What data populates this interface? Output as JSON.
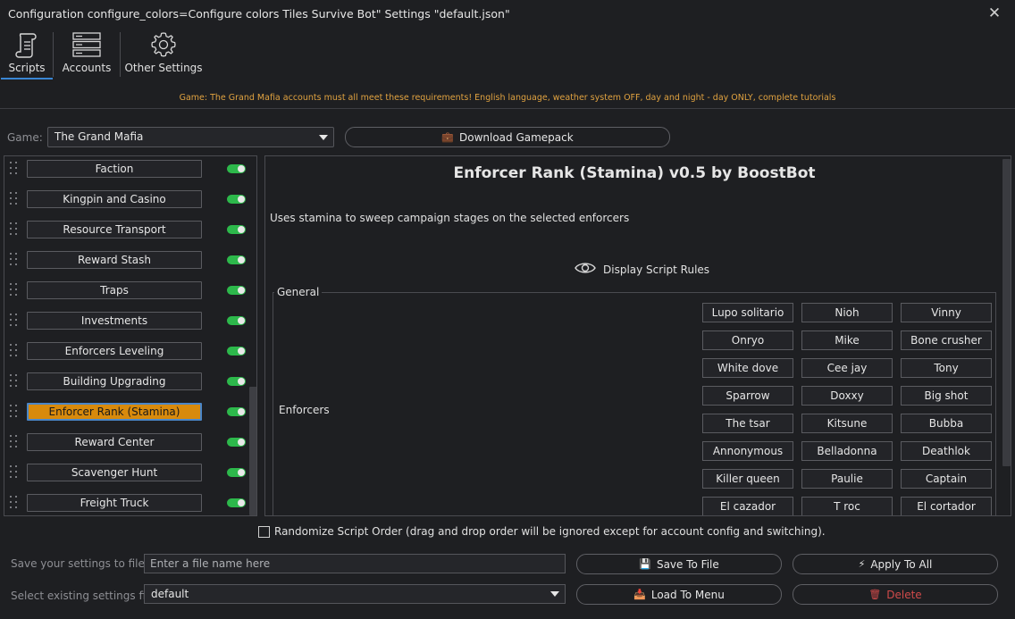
{
  "window": {
    "title": "Configuration configure_colors=Configure colors Tiles Survive Bot\" Settings \"default.json\"",
    "close_icon": "close-icon"
  },
  "tabs": [
    {
      "label": "Scripts",
      "icon": "scroll-icon",
      "active": true
    },
    {
      "label": "Accounts",
      "icon": "server-icon",
      "active": false
    },
    {
      "label": "Other Settings",
      "icon": "gear-icon",
      "active": false
    }
  ],
  "notice": "Game: The Grand Mafia accounts must all meet these requirements! English language, weather system OFF, day and night - day ONLY, complete tutorials",
  "game": {
    "label": "Game:",
    "selected": "The Grand Mafia",
    "download_label": "Download Gamepack"
  },
  "scripts": [
    {
      "name": "Faction",
      "enabled": true,
      "selected": false
    },
    {
      "name": "Kingpin and Casino",
      "enabled": true,
      "selected": false
    },
    {
      "name": "Resource Transport",
      "enabled": true,
      "selected": false
    },
    {
      "name": "Reward Stash",
      "enabled": true,
      "selected": false
    },
    {
      "name": "Traps",
      "enabled": true,
      "selected": false
    },
    {
      "name": "Investments",
      "enabled": true,
      "selected": false
    },
    {
      "name": "Enforcers Leveling",
      "enabled": true,
      "selected": false
    },
    {
      "name": "Building Upgrading",
      "enabled": true,
      "selected": false
    },
    {
      "name": "Enforcer Rank (Stamina)",
      "enabled": true,
      "selected": true
    },
    {
      "name": "Reward Center",
      "enabled": true,
      "selected": false
    },
    {
      "name": "Scavenger Hunt",
      "enabled": true,
      "selected": false
    },
    {
      "name": "Freight Truck",
      "enabled": true,
      "selected": false
    }
  ],
  "detail": {
    "title": "Enforcer Rank (Stamina) v0.5 by BoostBot",
    "description": "Uses stamina to sweep campaign stages on the selected enforcers",
    "rules_label": "Display Script Rules",
    "group_title": "General",
    "enforcers_label": "Enforcers",
    "enforcers": [
      "Lupo solitario",
      "Nioh",
      "Vinny",
      "Onryo",
      "Mike",
      "Bone crusher",
      "White dove",
      "Cee jay",
      "Tony",
      "Sparrow",
      "Doxxy",
      "Big shot",
      "The tsar",
      "Kitsune",
      "Bubba",
      "Annonymous",
      "Belladonna",
      "Deathlok",
      "Killer queen",
      "Paulie",
      "Captain",
      "El cazador",
      "T roc",
      "El cortador"
    ]
  },
  "randomize_label": "Randomize Script Order (drag and drop order will be ignored except for account config and switching).",
  "bottom": {
    "save_label": "Save your settings to file",
    "filename_placeholder": "Enter a file name here",
    "save_button": "Save To File",
    "apply_button": "Apply To All",
    "select_label": "Select existing settings file",
    "selected_file": "default",
    "load_button": "Load To Menu",
    "delete_button": "Delete"
  },
  "colors": {
    "accent": "#3a86d4",
    "selected_script": "#d88a0c",
    "toggle_on": "#2db84b",
    "warning_text": "#e0a240",
    "delete_text": "#d04a4a"
  }
}
